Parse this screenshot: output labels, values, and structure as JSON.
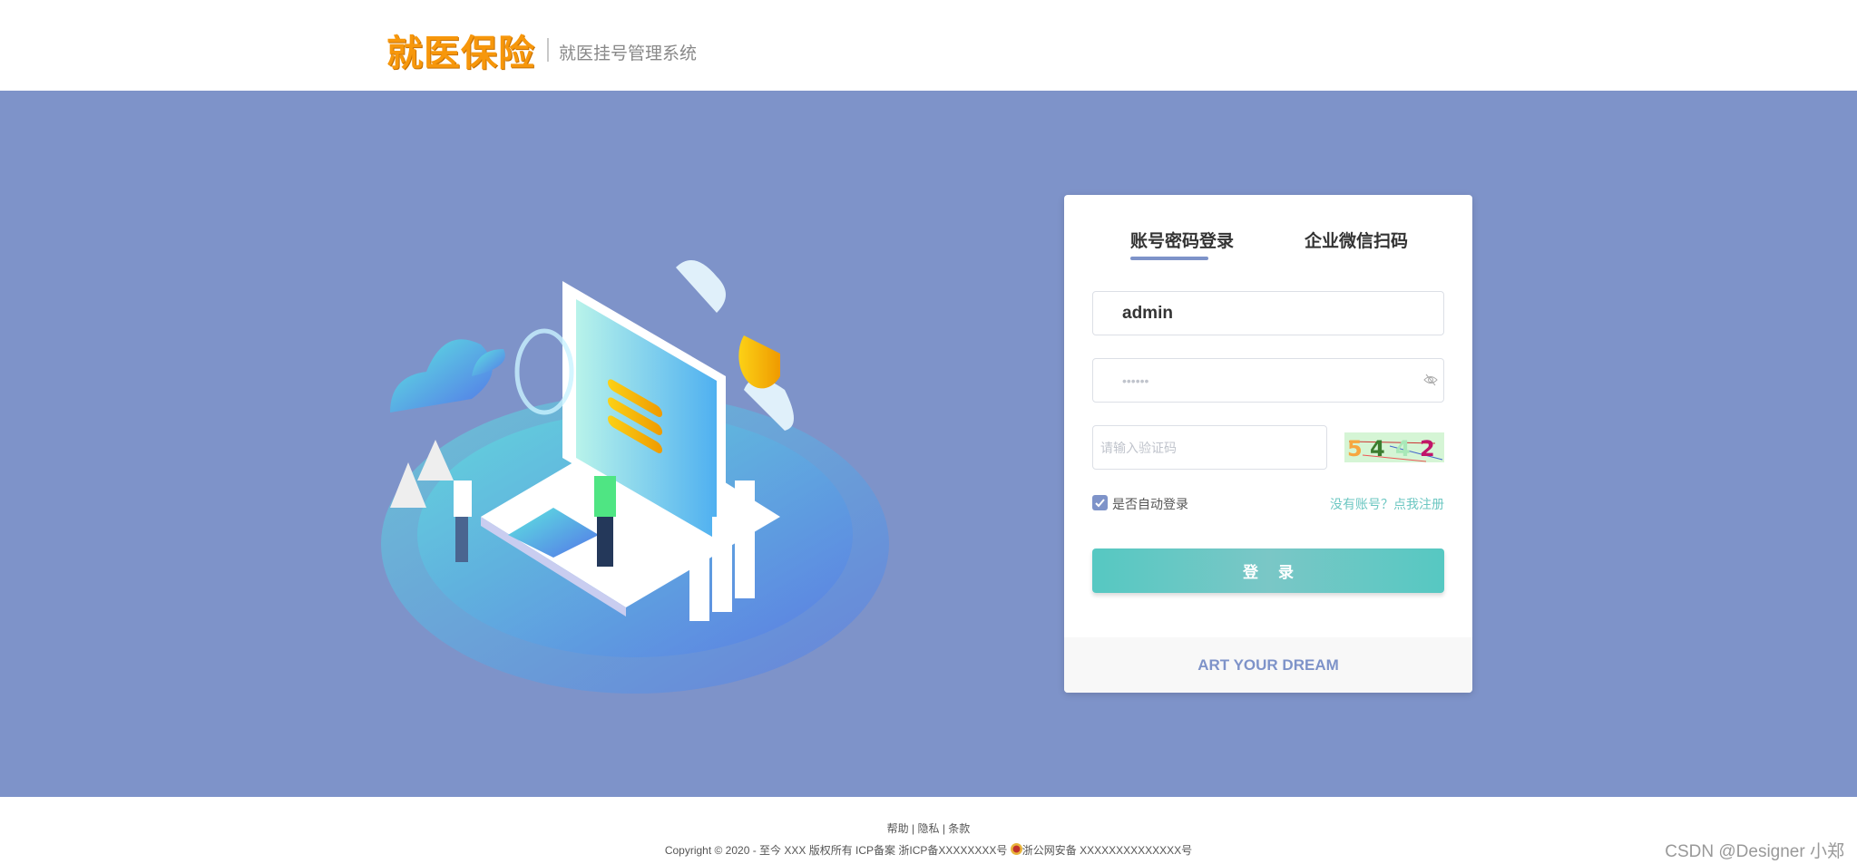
{
  "header": {
    "logo": "就医保险",
    "subtitle": "就医挂号管理系统"
  },
  "login": {
    "tabs": [
      {
        "label": "账号密码登录",
        "active": true
      },
      {
        "label": "企业微信扫码",
        "active": false
      }
    ],
    "username": {
      "value": "admin"
    },
    "password": {
      "value": "••••••"
    },
    "captcha": {
      "placeholder": "请输入验证码",
      "image_text": "5442"
    },
    "remember": {
      "label": "是否自动登录",
      "checked": true
    },
    "register_link": "没有账号？点我注册",
    "submit_label": "登录",
    "footer_slogan": "ART YOUR DREAM"
  },
  "footer": {
    "links": [
      "帮助",
      "隐私",
      "条款"
    ],
    "copyright": "Copyright © 2020 - 至今 XXX 版权所有 ICP备案 浙ICP备XXXXXXXX号",
    "police": "浙公网安备 XXXXXXXXXXXXXX号"
  },
  "watermark": "CSDN @Designer 小郑",
  "colors": {
    "brand": "#7e93c9",
    "accent": "#56c8c2",
    "logo": "#f7970b"
  }
}
